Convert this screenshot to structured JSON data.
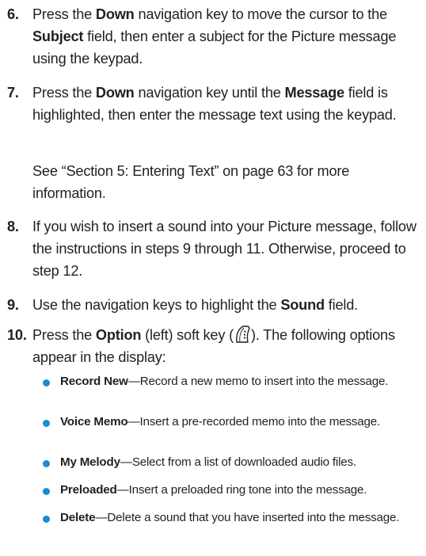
{
  "steps": [
    {
      "num": "6.",
      "t1": "Press the ",
      "b1": "Down",
      "t2": " navigation key to move the cursor to the ",
      "b2": "Subject",
      "t3": " field, then enter a subject for the Picture message using the keypad."
    },
    {
      "num": "7.",
      "t1": "Press the ",
      "b1": "Down",
      "t2": " navigation key until the ",
      "b2": "Message",
      "t3": " field is highlighted, then enter the message text using the keypad."
    },
    {
      "num": "8.",
      "t1": "If you wish to insert a sound into your Picture message, follow the instructions in steps 9 through 11. Otherwise, proceed to step 12."
    },
    {
      "num": "9.",
      "t1": "Use the navigation keys to highlight the ",
      "b1": "Sound",
      "t2": " field."
    },
    {
      "num": "10.",
      "t1": "Press the ",
      "b1": "Option",
      "t2": " (left) soft key (",
      "t3": "). The following options appear in the display:"
    }
  ],
  "see_also": "See “Section 5: Entering Text” on page 63 for more information.",
  "options": [
    {
      "label": "Record New",
      "desc": "—Record a new memo to insert into the message."
    },
    {
      "label": "Voice Memo",
      "desc": "—Insert a pre-recorded memo into the message."
    },
    {
      "label": "My Melody",
      "desc": "—Select from a list of downloaded audio files."
    },
    {
      "label": "Preloaded",
      "desc": "—Insert a preloaded ring tone into the message."
    },
    {
      "label": "Delete",
      "desc": "—Delete a sound that you have inserted into the message."
    }
  ],
  "colors": {
    "text": "#231f20",
    "bullet": "#1a8ad4"
  },
  "icons": {
    "soft_key": "left-soft-key-icon",
    "bullet": "bullet-dot-icon"
  }
}
